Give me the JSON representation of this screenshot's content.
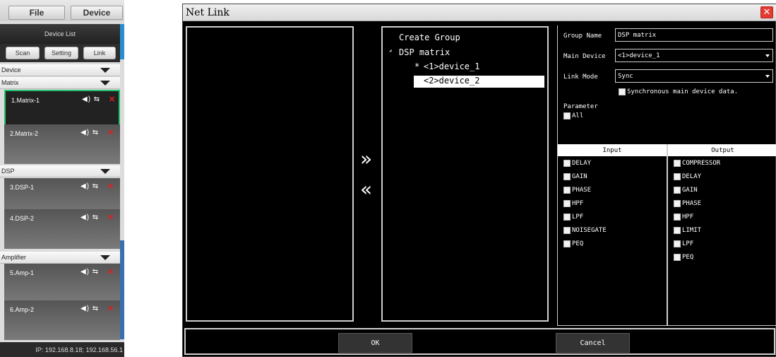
{
  "menu": {
    "file_label": "File",
    "device_label": "Device"
  },
  "device_list": {
    "title": "Device List",
    "buttons": {
      "scan": "Scan",
      "setting": "Setting",
      "link": "Link"
    },
    "groups": {
      "device": "Device",
      "matrix": "Matrix",
      "dsp": "DSP",
      "amplifier": "Amplifier"
    },
    "devices": [
      {
        "name": "1.Matrix-1",
        "icons": "◀) ⇆",
        "remove": "✕"
      },
      {
        "name": "2.Matrix-2",
        "icons": "◀) ⇆",
        "remove": "✕"
      },
      {
        "name": "3.DSP-1",
        "icons": "◀) ⇆",
        "remove": "✕"
      },
      {
        "name": "4.DSP-2",
        "icons": "◀) ⇆",
        "remove": "✕"
      },
      {
        "name": "5.Amp-1",
        "icons": "◀) ⇆",
        "remove": "✕"
      },
      {
        "name": "6.Amp-2",
        "icons": "◀) ⇆",
        "remove": "✕"
      }
    ],
    "ip_text": "IP: 192.168.8.18;  192.168.56.1"
  },
  "dialog": {
    "title": "Net Link",
    "close_icon": "✕",
    "tree": {
      "create_group": "Create Group",
      "group_toggle": "◢",
      "group_name": "DSP matrix",
      "main_marker": "*",
      "items": [
        "<1>device_1",
        "<2>device_2"
      ]
    },
    "arrows": {
      "add": "»",
      "remove": "«"
    },
    "form": {
      "group_name_label": "Group Name",
      "group_name_value": "DSP matrix",
      "main_device_label": "Main Device",
      "main_device_value": "<1>device_1",
      "link_mode_label": "Link Mode",
      "link_mode_value": "Sync",
      "sync_main_label": "Synchronous main device data.",
      "parameter_label": "Parameter",
      "all_label": "All",
      "input_header": "Input",
      "output_header": "Output",
      "inputs": [
        "DELAY",
        "GAIN",
        "PHASE",
        "HPF",
        "LPF",
        "NOISEGATE",
        "PEQ"
      ],
      "outputs": [
        "COMPRESSOR",
        "DELAY",
        "GAIN",
        "PHASE",
        "HPF",
        "LIMIT",
        "LPF",
        "PEQ"
      ]
    },
    "buttons": {
      "ok": "OK",
      "cancel": "Cancel"
    }
  },
  "colors": {
    "active_border": "#22c26a",
    "close_red": "#e33b2f",
    "remove_red": "#e02020"
  }
}
